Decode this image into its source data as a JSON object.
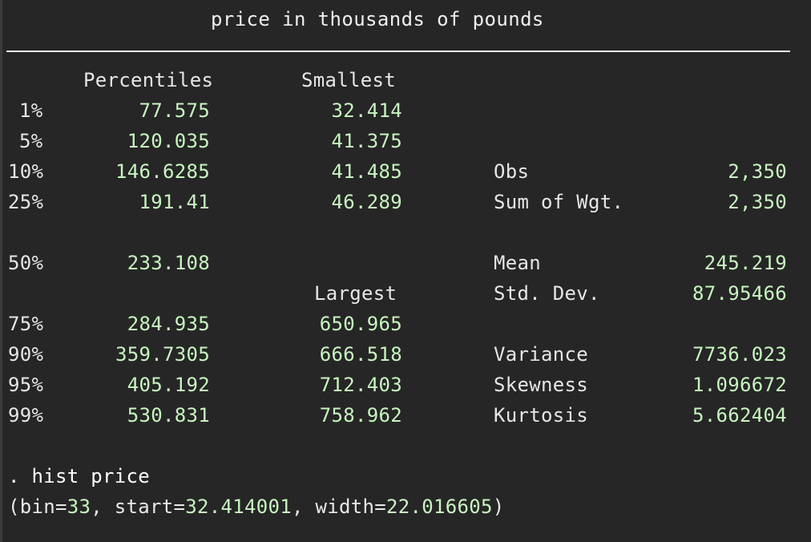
{
  "title": "price in thousands of pounds",
  "headers": {
    "percentiles": "Percentiles",
    "smallest": "Smallest",
    "largest": "Largest"
  },
  "rows": [
    {
      "pct": "1%",
      "percentile": "77.575",
      "extreme": "32.414"
    },
    {
      "pct": "5%",
      "percentile": "120.035",
      "extreme": "41.375"
    },
    {
      "pct": "10%",
      "percentile": "146.6285",
      "extreme": "41.485",
      "stat_label": "Obs",
      "stat_value": "2,350"
    },
    {
      "pct": "25%",
      "percentile": "191.41",
      "extreme": "46.289",
      "stat_label": "Sum of Wgt.",
      "stat_value": "2,350"
    },
    {
      "pct": "50%",
      "percentile": "233.108",
      "stat_label": "Mean",
      "stat_value": "245.219"
    },
    {
      "stat_label": "Std. Dev.",
      "stat_value": "87.95466"
    },
    {
      "pct": "75%",
      "percentile": "284.935",
      "extreme": "650.965"
    },
    {
      "pct": "90%",
      "percentile": "359.7305",
      "extreme": "666.518",
      "stat_label": "Variance",
      "stat_value": "7736.023"
    },
    {
      "pct": "95%",
      "percentile": "405.192",
      "extreme": "712.403",
      "stat_label": "Skewness",
      "stat_value": "1.096672"
    },
    {
      "pct": "99%",
      "percentile": "530.831",
      "extreme": "758.962",
      "stat_label": "Kurtosis",
      "stat_value": "5.662404"
    }
  ],
  "command": {
    "line": ". hist price",
    "output_open": "(bin=",
    "bin": "33",
    "sep1": ", start=",
    "start": "32.414001",
    "sep2": ", width=",
    "width": "22.016605",
    "output_close": ")"
  }
}
